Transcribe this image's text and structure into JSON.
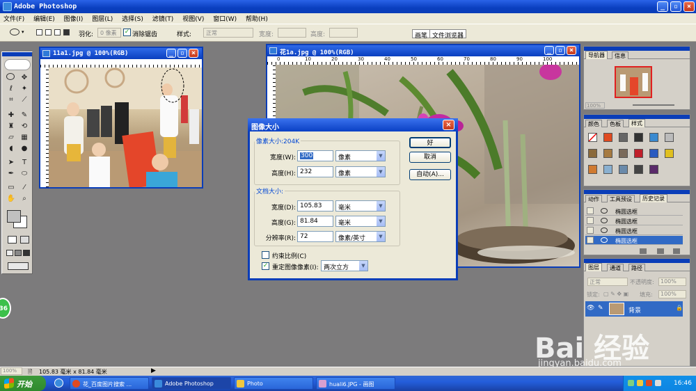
{
  "app": {
    "title": "Adobe Photoshop"
  },
  "menu": [
    "文件(F)",
    "编辑(E)",
    "图像(I)",
    "图层(L)",
    "选择(S)",
    "滤镜(T)",
    "视图(V)",
    "窗口(W)",
    "帮助(H)"
  ],
  "options": {
    "feather_label": "羽化:",
    "feather_value": "0 像素",
    "antialias_label": "消除锯齿",
    "style_label": "样式:",
    "style_value": "正常",
    "width_label": "宽度:",
    "height_label": "高度:",
    "tab_brushes": "画笔",
    "tab_browser": "文件浏览器"
  },
  "doc1": {
    "title": "11a1.jpg @ 100%(RGB)"
  },
  "doc2": {
    "title": "花1a.jpg @ 100%(RGB)"
  },
  "ruler_numbers_doc2": [
    "0",
    "10",
    "20",
    "30",
    "40",
    "50",
    "60",
    "70",
    "80",
    "90",
    "100"
  ],
  "dialog": {
    "title": "图像大小",
    "pixel_dim_label": "像素大小:204K",
    "width_label": "宽度(W):",
    "width_value": "300",
    "width_unit": "像素",
    "height_label": "高度(H):",
    "height_value": "232",
    "height_unit": "像素",
    "doc_size_label": "文档大小:",
    "doc_width_label": "宽度(D):",
    "doc_width_value": "105.83",
    "doc_width_unit": "毫米",
    "doc_height_label": "高度(G):",
    "doc_height_value": "81.84",
    "doc_height_unit": "毫米",
    "resolution_label": "分辨率(R):",
    "resolution_value": "72",
    "resolution_unit": "像素/英寸",
    "constrain_label": "约束比例(C)",
    "resample_label": "重定图像像素(I):",
    "resample_value": "两次立方",
    "ok": "好",
    "cancel": "取消",
    "auto": "自动(A)..."
  },
  "navigator": {
    "tab_nav": "导航器",
    "tab_info": "信息",
    "zoom": "100%"
  },
  "swatches": {
    "tab_color": "颜色",
    "tab_swatches": "色板",
    "tab_styles": "样式"
  },
  "history": {
    "tab_actions": "动作",
    "tab_presets": "工具预设",
    "tab_history": "历史记录",
    "items": [
      "椭圆选框",
      "椭圆选框",
      "椭圆选框",
      "椭圆选框"
    ]
  },
  "layers": {
    "tab_layers": "图层",
    "tab_channels": "通道",
    "tab_paths": "路径",
    "blend": "正常",
    "opacity_label": "不透明度:",
    "opacity_value": "100%",
    "lock_label": "锁定:",
    "fill_label": "填充:",
    "fill_value": "100%",
    "layer_name": "背景"
  },
  "status": {
    "zoom": "100%",
    "doc_size": "105.83 毫米 x 81.84 毫米"
  },
  "taskbar": {
    "start": "开始",
    "tasks": [
      "花_百度图片搜索 ...",
      "Adobe Photoshop",
      "Photo",
      "huali6.JPG - 画图"
    ],
    "time": "16:46"
  },
  "watermark": {
    "brand": "Bai  经验",
    "url": "jingyan.baidu.com"
  },
  "badge": "36",
  "colors": {
    "xp_blue": "#0a3db8",
    "dialog_bg": "#ece9d8",
    "legend": "#0046d5"
  }
}
